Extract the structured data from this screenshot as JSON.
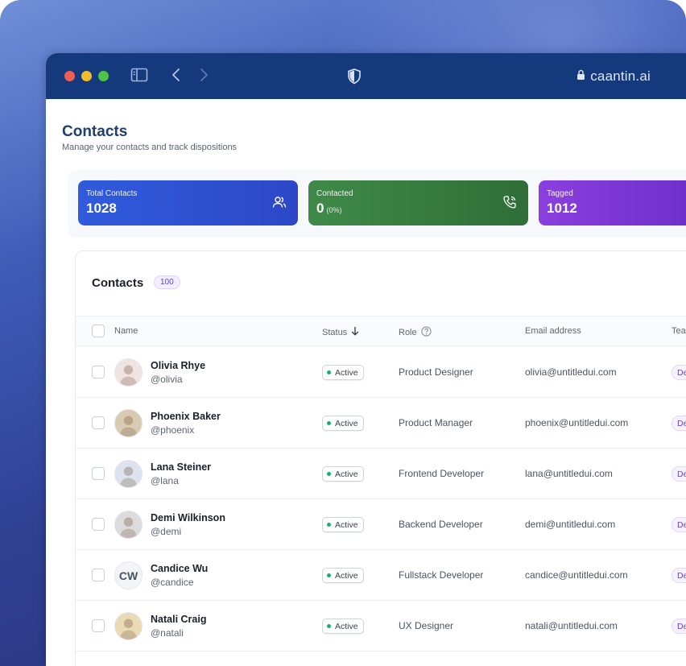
{
  "browser": {
    "url": "caantin.ai"
  },
  "page": {
    "title": "Contacts",
    "subtitle": "Manage your contacts and track dispositions"
  },
  "stats": [
    {
      "label": "Total Contacts",
      "value": "1028",
      "icon": "users-icon",
      "color": "#2f5bdc"
    },
    {
      "label": "Contacted",
      "value": "0",
      "percent": "(0%)",
      "icon": "phone-call-icon",
      "color": "#3f8a49"
    },
    {
      "label": "Tagged",
      "value": "1012",
      "color": "#8a3fde"
    }
  ],
  "table": {
    "title": "Contacts",
    "count": "100",
    "columns": {
      "name": "Name",
      "status": "Status",
      "role": "Role",
      "email": "Email address",
      "team": "Tea"
    },
    "rows": [
      {
        "name": "Olivia Rhye",
        "handle": "@olivia",
        "status": "Active",
        "role": "Product Designer",
        "email": "olivia@untitledui.com",
        "team": "De",
        "avatar": "photo",
        "avatar_color": "#f0e4e2"
      },
      {
        "name": "Phoenix Baker",
        "handle": "@phoenix",
        "status": "Active",
        "role": "Product Manager",
        "email": "phoenix@untitledui.com",
        "team": "De",
        "avatar": "photo",
        "avatar_color": "#d9cbb2"
      },
      {
        "name": "Lana Steiner",
        "handle": "@lana",
        "status": "Active",
        "role": "Frontend Developer",
        "email": "lana@untitledui.com",
        "team": "De",
        "avatar": "photo",
        "avatar_color": "#dde2ee"
      },
      {
        "name": "Demi Wilkinson",
        "handle": "@demi",
        "status": "Active",
        "role": "Backend Developer",
        "email": "demi@untitledui.com",
        "team": "De",
        "avatar": "photo",
        "avatar_color": "#dcdcdc"
      },
      {
        "name": "Candice Wu",
        "handle": "@candice",
        "status": "Active",
        "role": "Fullstack Developer",
        "email": "candice@untitledui.com",
        "team": "De",
        "avatar": "CW",
        "avatar_color": "#f3f4f7"
      },
      {
        "name": "Natali Craig",
        "handle": "@natali",
        "status": "Active",
        "role": "UX Designer",
        "email": "natali@untitledui.com",
        "team": "De",
        "avatar": "photo",
        "avatar_color": "#eadbb6"
      }
    ]
  }
}
